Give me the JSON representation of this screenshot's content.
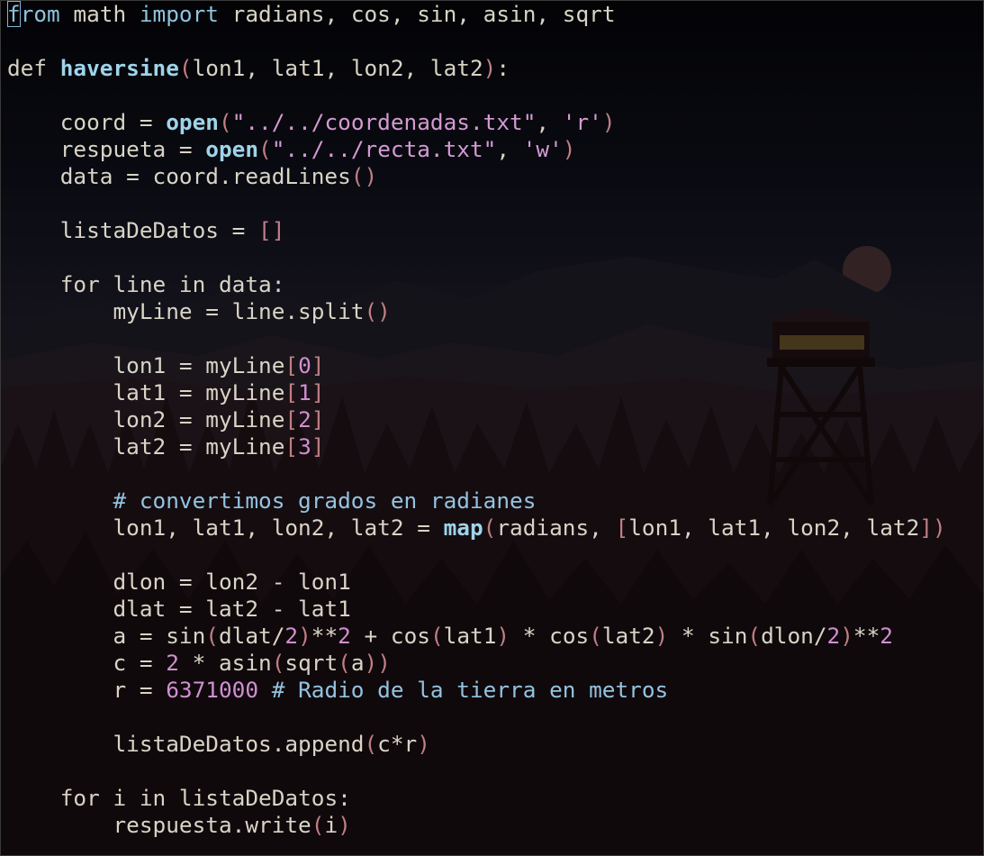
{
  "editor": {
    "language": "python",
    "cursor": {
      "line": 1,
      "column": 1
    },
    "lines": [
      [
        [
          "imp",
          "from"
        ],
        [
          "id",
          " math "
        ],
        [
          "imp",
          "import"
        ],
        [
          "id",
          " radians, cos, sin, asin, sqrt"
        ]
      ],
      [],
      [
        [
          "kw",
          "def "
        ],
        [
          "fn",
          "haversine"
        ],
        [
          "br",
          "("
        ],
        [
          "id",
          "lon1, lat1, lon2, lat2"
        ],
        [
          "br",
          ")"
        ],
        [
          "id",
          ":"
        ]
      ],
      [],
      [
        [
          "id",
          "    coord = "
        ],
        [
          "fn",
          "open"
        ],
        [
          "br",
          "("
        ],
        [
          "str",
          "\"../../coordenadas.txt\""
        ],
        [
          "id",
          ", "
        ],
        [
          "str",
          "'r'"
        ],
        [
          "br",
          ")"
        ]
      ],
      [
        [
          "id",
          "    respueta = "
        ],
        [
          "fn",
          "open"
        ],
        [
          "br",
          "("
        ],
        [
          "str",
          "\"../../recta.txt\""
        ],
        [
          "id",
          ", "
        ],
        [
          "str",
          "'w'"
        ],
        [
          "br",
          ")"
        ]
      ],
      [
        [
          "id",
          "    data = coord.readLines"
        ],
        [
          "br",
          "()"
        ]
      ],
      [],
      [
        [
          "id",
          "    listaDeDatos = "
        ],
        [
          "br",
          "[]"
        ]
      ],
      [],
      [
        [
          "kw",
          "    for"
        ],
        [
          "id",
          " line "
        ],
        [
          "kw",
          "in"
        ],
        [
          "id",
          " data:"
        ]
      ],
      [
        [
          "id",
          "        myLine = line.split"
        ],
        [
          "br",
          "()"
        ]
      ],
      [],
      [
        [
          "id",
          "        lon1 = myLine"
        ],
        [
          "br",
          "["
        ],
        [
          "num",
          "0"
        ],
        [
          "br",
          "]"
        ]
      ],
      [
        [
          "id",
          "        lat1 = myLine"
        ],
        [
          "br",
          "["
        ],
        [
          "num",
          "1"
        ],
        [
          "br",
          "]"
        ]
      ],
      [
        [
          "id",
          "        lon2 = myLine"
        ],
        [
          "br",
          "["
        ],
        [
          "num",
          "2"
        ],
        [
          "br",
          "]"
        ]
      ],
      [
        [
          "id",
          "        lat2 = myLine"
        ],
        [
          "br",
          "["
        ],
        [
          "num",
          "3"
        ],
        [
          "br",
          "]"
        ]
      ],
      [],
      [
        [
          "cm",
          "        # convertimos grados en radianes"
        ]
      ],
      [
        [
          "id",
          "        lon1, lat1, lon2, lat2 = "
        ],
        [
          "fn",
          "map"
        ],
        [
          "br",
          "("
        ],
        [
          "id",
          "radians, "
        ],
        [
          "br",
          "["
        ],
        [
          "id",
          "lon1, lat1, lon2, lat2"
        ],
        [
          "br",
          "])"
        ]
      ],
      [],
      [
        [
          "id",
          "        dlon = lon2 - lon1"
        ]
      ],
      [
        [
          "id",
          "        dlat = lat2 - lat1"
        ]
      ],
      [
        [
          "id",
          "        a = sin"
        ],
        [
          "br",
          "("
        ],
        [
          "id",
          "dlat/"
        ],
        [
          "num",
          "2"
        ],
        [
          "br",
          ")"
        ],
        [
          "id",
          "**"
        ],
        [
          "num",
          "2"
        ],
        [
          "id",
          " + cos"
        ],
        [
          "br",
          "("
        ],
        [
          "id",
          "lat1"
        ],
        [
          "br",
          ")"
        ],
        [
          "id",
          " * cos"
        ],
        [
          "br",
          "("
        ],
        [
          "id",
          "lat2"
        ],
        [
          "br",
          ")"
        ],
        [
          "id",
          " * sin"
        ],
        [
          "br",
          "("
        ],
        [
          "id",
          "dlon/"
        ],
        [
          "num",
          "2"
        ],
        [
          "br",
          ")"
        ],
        [
          "id",
          "**"
        ],
        [
          "num",
          "2"
        ]
      ],
      [
        [
          "id",
          "        c = "
        ],
        [
          "num",
          "2"
        ],
        [
          "id",
          " * asin"
        ],
        [
          "br",
          "("
        ],
        [
          "id",
          "sqrt"
        ],
        [
          "br",
          "("
        ],
        [
          "id",
          "a"
        ],
        [
          "br",
          "))"
        ]
      ],
      [
        [
          "id",
          "        r = "
        ],
        [
          "num",
          "6371000"
        ],
        [
          "cm",
          " # Radio de la tierra en metros"
        ]
      ],
      [],
      [
        [
          "id",
          "        listaDeDatos.append"
        ],
        [
          "br",
          "("
        ],
        [
          "id",
          "c*r"
        ],
        [
          "br",
          ")"
        ]
      ],
      [],
      [
        [
          "kw",
          "    for"
        ],
        [
          "id",
          " i "
        ],
        [
          "kw",
          "in"
        ],
        [
          "id",
          " listaDeDatos:"
        ]
      ],
      [
        [
          "id",
          "        respuesta.write"
        ],
        [
          "br",
          "("
        ],
        [
          "id",
          "i"
        ],
        [
          "br",
          ")"
        ]
      ]
    ]
  },
  "colors": {
    "keyword": "#d7d2c2",
    "import_keyword": "#8fc3dd",
    "builtin_function": "#9fd4ea",
    "string": "#d49ad4",
    "number": "#d08fd0",
    "bracket": "#c07f84",
    "comment": "#93c3e0",
    "identifier": "#d8d4c6",
    "cursor": "#7fb4d8"
  },
  "wallpaper": {
    "icons": [
      "mountains-icon",
      "moon-icon",
      "fire-lookout-tower-icon",
      "pine-forest-icon"
    ]
  }
}
